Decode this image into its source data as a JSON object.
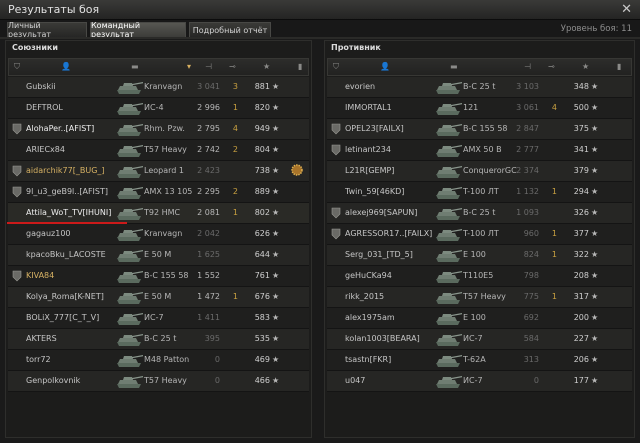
{
  "window": {
    "title": "Результаты боя",
    "close_icon": "close-icon"
  },
  "tabs": [
    {
      "label": "Личный результат",
      "active": false
    },
    {
      "label": "Командный результат",
      "active": true
    },
    {
      "label": "Подробный отчёт",
      "active": false
    }
  ],
  "battle_level": "Уровень боя: 11",
  "allies": {
    "title": "Союзники",
    "rows": [
      {
        "name": "Gubskii",
        "tank": "Kranvagn",
        "dmg": "3 041",
        "frags": "3",
        "xp": "881",
        "dead": true,
        "platoon": false,
        "style": "normal"
      },
      {
        "name": "DEFTROL",
        "tank": "ИС-4",
        "dmg": "2 996",
        "frags": "1",
        "xp": "820",
        "dead": false,
        "platoon": false,
        "style": "normal"
      },
      {
        "name": "AlohaPer..[AFIST]",
        "tank": "Rhm. Pzw.",
        "dmg": "2 795",
        "frags": "4",
        "xp": "949",
        "dead": false,
        "platoon": true,
        "style": "white"
      },
      {
        "name": "ARIECx84",
        "tank": "T57 Heavy",
        "dmg": "2 742",
        "frags": "2",
        "xp": "804",
        "dead": false,
        "platoon": false,
        "style": "normal"
      },
      {
        "name": "aidarchik77[_BUG_]",
        "tank": "Leopard 1",
        "dmg": "2 423",
        "frags": "",
        "xp": "738",
        "dead": true,
        "platoon": true,
        "style": "gold",
        "medal": true
      },
      {
        "name": "9l_u3_geB9l..[AFIST]",
        "tank": "AMX 13 105",
        "dmg": "2 295",
        "frags": "2",
        "xp": "889",
        "dead": false,
        "platoon": true,
        "style": "normal"
      },
      {
        "name": "Attila_WoT_TV[IHUNI]",
        "tank": "T92 HMC",
        "dmg": "2 081",
        "frags": "1",
        "xp": "802",
        "dead": false,
        "platoon": false,
        "style": "white"
      },
      {
        "name": "gagauz100",
        "tank": "Kranvagn",
        "dmg": "2 042",
        "frags": "",
        "xp": "626",
        "dead": true,
        "platoon": false,
        "style": "normal"
      },
      {
        "name": "kpacoBku_LACOSTE",
        "tank": "E 50 M",
        "dmg": "1 625",
        "frags": "",
        "xp": "644",
        "dead": true,
        "platoon": false,
        "style": "normal"
      },
      {
        "name": "KIVA84",
        "tank": "B-C 155 58",
        "dmg": "1 552",
        "frags": "",
        "xp": "761",
        "dead": false,
        "platoon": true,
        "style": "gold"
      },
      {
        "name": "Kolya_Roma[K-NET]",
        "tank": "E 50 M",
        "dmg": "1 472",
        "frags": "1",
        "xp": "676",
        "dead": false,
        "platoon": false,
        "style": "normal"
      },
      {
        "name": "BOLiX_777[C_T_V]",
        "tank": "ИС-7",
        "dmg": "1 411",
        "frags": "",
        "xp": "583",
        "dead": true,
        "platoon": false,
        "style": "normal"
      },
      {
        "name": "AKTERS",
        "tank": "B-C 25 t",
        "dmg": "395",
        "frags": "",
        "xp": "535",
        "dead": true,
        "platoon": false,
        "style": "normal"
      },
      {
        "name": "torr72",
        "tank": "M48 Patton",
        "dmg": "0",
        "frags": "",
        "xp": "469",
        "dead": true,
        "platoon": false,
        "style": "normal"
      },
      {
        "name": "Genpolkovnik",
        "tank": "T57 Heavy",
        "dmg": "0",
        "frags": "",
        "xp": "466",
        "dead": true,
        "platoon": false,
        "style": "normal"
      }
    ]
  },
  "enemies": {
    "title": "Противник",
    "rows": [
      {
        "name": "evorien",
        "tank": "B-C 25 t",
        "dmg": "3 103",
        "frags": "",
        "xp": "348",
        "dead": true,
        "platoon": false,
        "style": "normal"
      },
      {
        "name": "IMMORTAL1",
        "tank": "121",
        "dmg": "3 061",
        "frags": "4",
        "xp": "500",
        "dead": true,
        "platoon": false,
        "style": "normal"
      },
      {
        "name": "OPEL23[FAILX]",
        "tank": "B-C 155 58",
        "dmg": "2 847",
        "frags": "",
        "xp": "375",
        "dead": true,
        "platoon": true,
        "style": "normal"
      },
      {
        "name": "letinant234",
        "tank": "AMX 50 B",
        "dmg": "2 777",
        "frags": "",
        "xp": "341",
        "dead": true,
        "platoon": true,
        "style": "normal"
      },
      {
        "name": "L21R[GEMP]",
        "tank": "ConquerorGC",
        "dmg": "2 374",
        "frags": "",
        "xp": "379",
        "dead": true,
        "platoon": false,
        "style": "normal"
      },
      {
        "name": "Twin_59[46KD]",
        "tank": "T-100 ЛТ",
        "dmg": "1 132",
        "frags": "1",
        "xp": "294",
        "dead": true,
        "platoon": false,
        "style": "normal"
      },
      {
        "name": "alexej969[SAPUN]",
        "tank": "B-C 25 t",
        "dmg": "1 093",
        "frags": "",
        "xp": "326",
        "dead": true,
        "platoon": true,
        "style": "normal"
      },
      {
        "name": "AGRESSOR17..[FAILX]",
        "tank": "T-100 ЛТ",
        "dmg": "960",
        "frags": "1",
        "xp": "377",
        "dead": true,
        "platoon": true,
        "style": "normal"
      },
      {
        "name": "Serg_031_[TD_5]",
        "tank": "E 100",
        "dmg": "824",
        "frags": "1",
        "xp": "322",
        "dead": true,
        "platoon": false,
        "style": "normal"
      },
      {
        "name": "geHuCKa94",
        "tank": "T110E5",
        "dmg": "798",
        "frags": "",
        "xp": "208",
        "dead": true,
        "platoon": false,
        "style": "normal"
      },
      {
        "name": "rikk_2015",
        "tank": "T57 Heavy",
        "dmg": "775",
        "frags": "1",
        "xp": "317",
        "dead": true,
        "platoon": false,
        "style": "normal"
      },
      {
        "name": "alex1975am",
        "tank": "E 100",
        "dmg": "692",
        "frags": "",
        "xp": "200",
        "dead": true,
        "platoon": false,
        "style": "normal"
      },
      {
        "name": "kolan1003[BEARA]",
        "tank": "ИС-7",
        "dmg": "584",
        "frags": "",
        "xp": "227",
        "dead": true,
        "platoon": false,
        "style": "normal"
      },
      {
        "name": "tsastn[FKR]",
        "tank": "T-62A",
        "dmg": "313",
        "frags": "",
        "xp": "206",
        "dead": true,
        "platoon": false,
        "style": "normal"
      },
      {
        "name": "u047",
        "tank": "ИС-7",
        "dmg": "0",
        "frags": "",
        "xp": "177",
        "dead": true,
        "platoon": false,
        "style": "normal"
      }
    ]
  },
  "colors": {
    "gold": "#d7b264",
    "frag": "#c8a040",
    "highlight_underline": "#cc1a1a",
    "bg": "#1a1a1a"
  },
  "icons": {
    "column_headers": [
      "squad-icon",
      "player-icon",
      "tank-icon",
      "damage-icon",
      "frags-icon",
      "experience-icon",
      "medal-icon"
    ],
    "row": [
      "platoon-icon",
      "tank-silhouette-icon",
      "star-icon",
      "medal-icon"
    ]
  }
}
